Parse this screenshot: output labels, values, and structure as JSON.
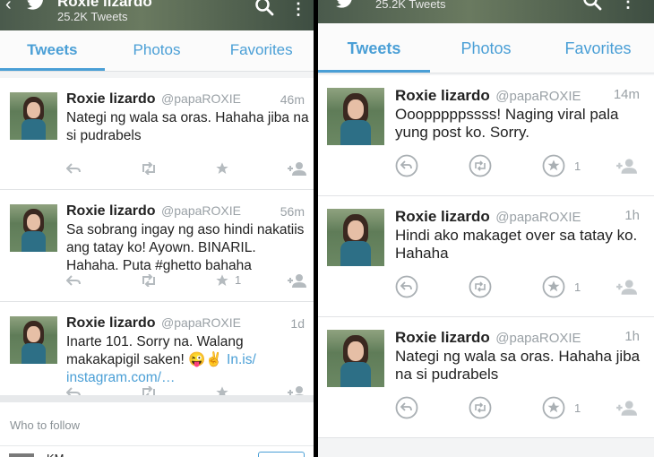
{
  "left": {
    "header": {
      "name": "Roxie lizardo",
      "tweet_count": "25.2K Tweets"
    },
    "tabs": [
      "Tweets",
      "Photos",
      "Favorites"
    ],
    "tweets": [
      {
        "name": "Roxie lizardo",
        "handle": "@papaROXIE",
        "time": "46m",
        "text": "Nategi ng wala sa oras. Hahaha jiba na si pudrabels",
        "link": "",
        "fav_count": ""
      },
      {
        "name": "Roxie lizardo",
        "handle": "@papaROXIE",
        "time": "56m",
        "text": "Sa sobrang ingay ng aso hindi nakatiis ang tatay ko! Ayown. BINARIL. Hahaha. Puta #ghetto bahaha",
        "link": "",
        "fav_count": "1"
      },
      {
        "name": "Roxie lizardo",
        "handle": "@papaROXIE",
        "time": "1d",
        "text": "Inarte 101. Sorry na. Walang makakapigil saken! 😜✌ ",
        "link": "In.is/ instagram.com/…",
        "fav_count": ""
      }
    ],
    "who_to_follow": {
      "title": "Who to follow",
      "first_name": "KM"
    }
  },
  "right": {
    "header": {
      "name": "",
      "tweet_count": "25.2K Tweets"
    },
    "tabs": [
      "Tweets",
      "Photos",
      "Favorites"
    ],
    "tweets": [
      {
        "name": "Roxie lizardo",
        "handle": "@papaROXIE",
        "time": "14m",
        "text": "Ooopppppssss! Naging viral pala yung post ko. Sorry.",
        "fav_count": "1"
      },
      {
        "name": "Roxie lizardo",
        "handle": "@papaROXIE",
        "time": "1h",
        "text": "Hindi ako makaget over sa tatay ko. Hahaha",
        "fav_count": "1"
      },
      {
        "name": "Roxie lizardo",
        "handle": "@papaROXIE",
        "time": "1h",
        "text": "Nategi ng wala sa oras. Hahaha jiba na si pudrabels",
        "fav_count": "1"
      }
    ]
  },
  "colors": {
    "accent": "#4a9fd6",
    "muted": "#9aa1a6",
    "icon": "#b5bbbf"
  },
  "icons": [
    "back-arrow-icon",
    "twitter-bird-icon",
    "search-icon",
    "more-vert-icon",
    "reply-icon",
    "retweet-icon",
    "favorite-star-icon",
    "follow-user-icon"
  ]
}
